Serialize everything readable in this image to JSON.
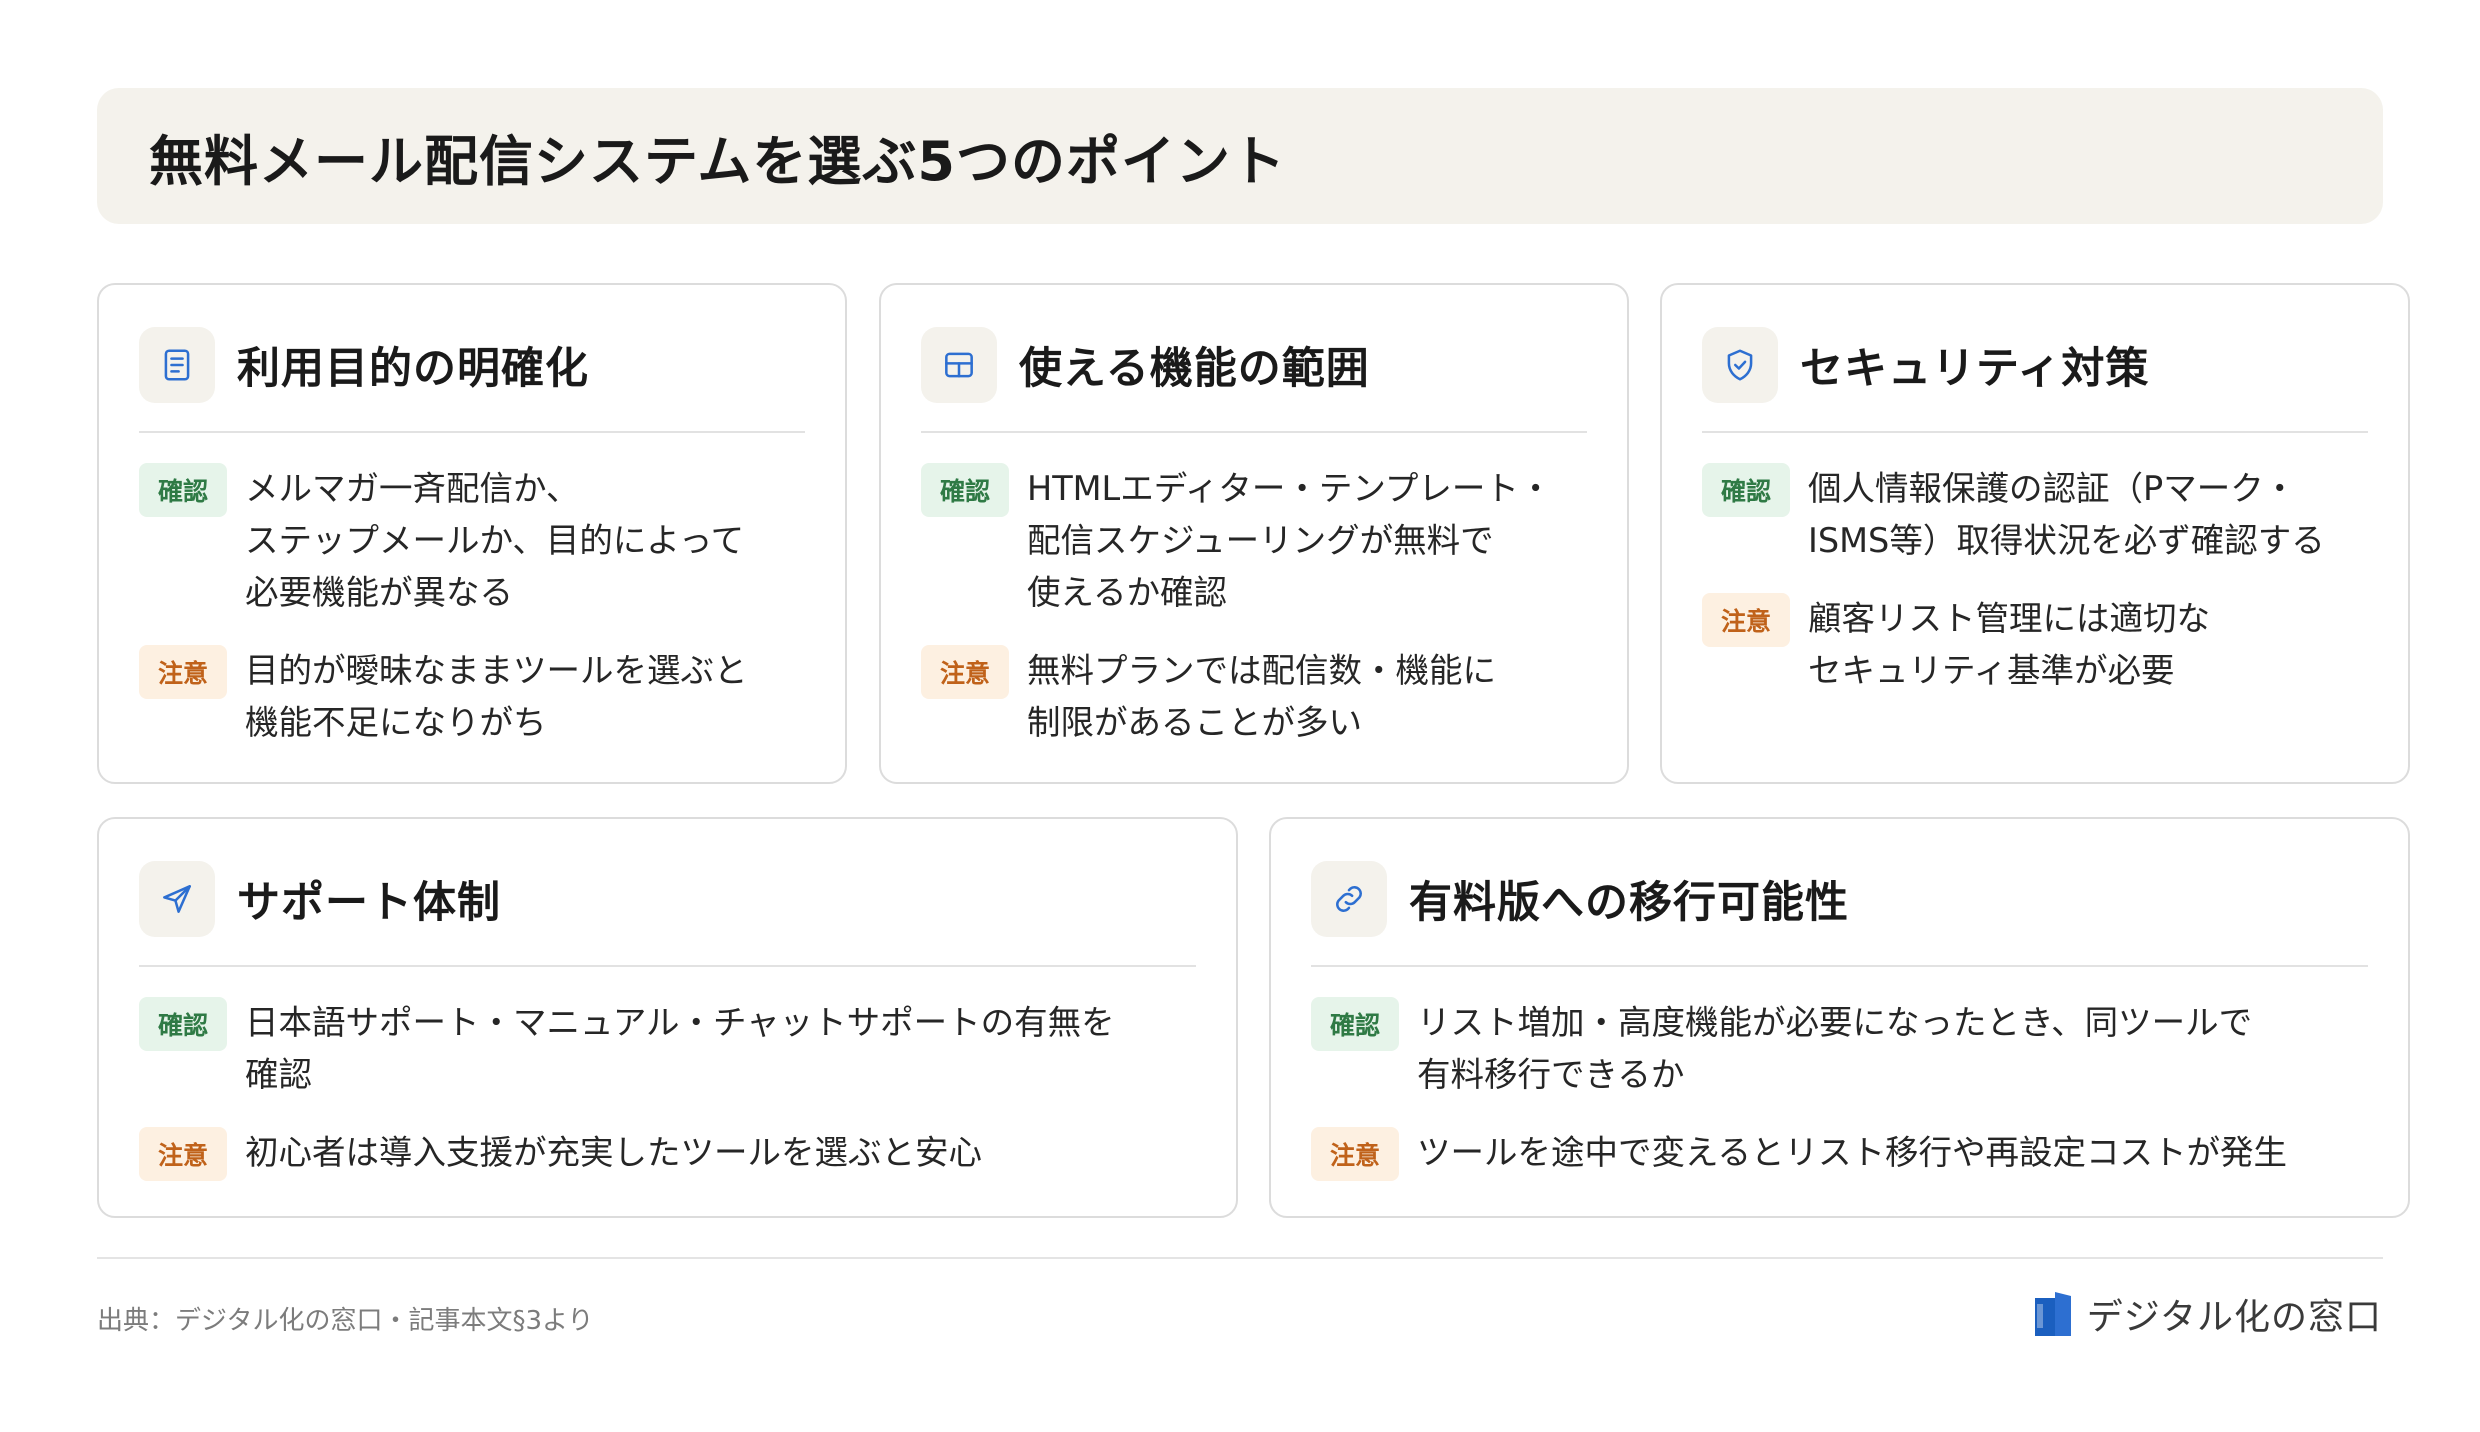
{
  "title": "無料メール配信システムを選ぶ5つのポイント",
  "tags": {
    "confirm": "確認",
    "caution": "注意"
  },
  "colors": {
    "accent_blue": "#2d6fd1",
    "confirm_green": "#2f7a45",
    "caution_orange": "#c0621a"
  },
  "cards": [
    {
      "icon": "document-icon",
      "title": "利用目的の明確化",
      "confirm": "メルマガ一斉配信か、\nステップメールか、目的によって\n必要機能が異なる",
      "caution": "目的が曖昧なままツールを選ぶと\n機能不足になりがち"
    },
    {
      "icon": "grid-icon",
      "title": "使える機能の範囲",
      "confirm": "HTMLエディター・テンプレート・\n配信スケジューリングが無料で\n使えるか確認",
      "caution": "無料プランでは配信数・機能に\n制限があることが多い"
    },
    {
      "icon": "shield-check-icon",
      "title": "セキュリティ対策",
      "confirm": "個人情報保護の認証（Pマーク・\nISMS等）取得状況を必ず確認する",
      "caution": "顧客リスト管理には適切な\nセキュリティ基準が必要"
    },
    {
      "icon": "send-icon",
      "title": "サポート体制",
      "confirm": "日本語サポート・マニュアル・チャットサポートの有無を\n確認",
      "caution": "初心者は導入支援が充実したツールを選ぶと安心"
    },
    {
      "icon": "link-icon",
      "title": "有料版への移行可能性",
      "confirm": "リスト増加・高度機能が必要になったとき、同ツールで\n有料移行できるか",
      "caution": "ツールを途中で変えるとリスト移行や再設定コストが発生"
    }
  ],
  "footer": {
    "source": "出典：デジタル化の窓口・記事本文§3より",
    "brand": "デジタル化の窓口"
  }
}
